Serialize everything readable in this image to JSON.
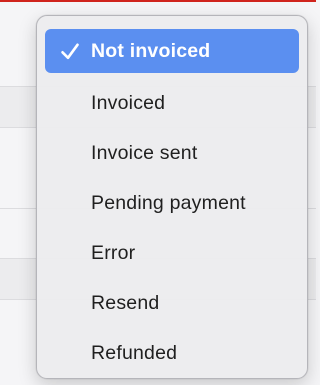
{
  "colors": {
    "accent": "#d0241d",
    "selection": "#5b8ff0",
    "menu_background": "#ececee",
    "text": "#1f1f1f"
  },
  "dropdown": {
    "items": [
      {
        "label": "Not invoiced",
        "selected": true,
        "icon": "checkmark-icon"
      },
      {
        "label": "Invoiced",
        "selected": false
      },
      {
        "label": "Invoice sent",
        "selected": false
      },
      {
        "label": "Pending payment",
        "selected": false
      },
      {
        "label": "Error",
        "selected": false
      },
      {
        "label": "Resend",
        "selected": false
      },
      {
        "label": "Refunded",
        "selected": false
      }
    ]
  }
}
